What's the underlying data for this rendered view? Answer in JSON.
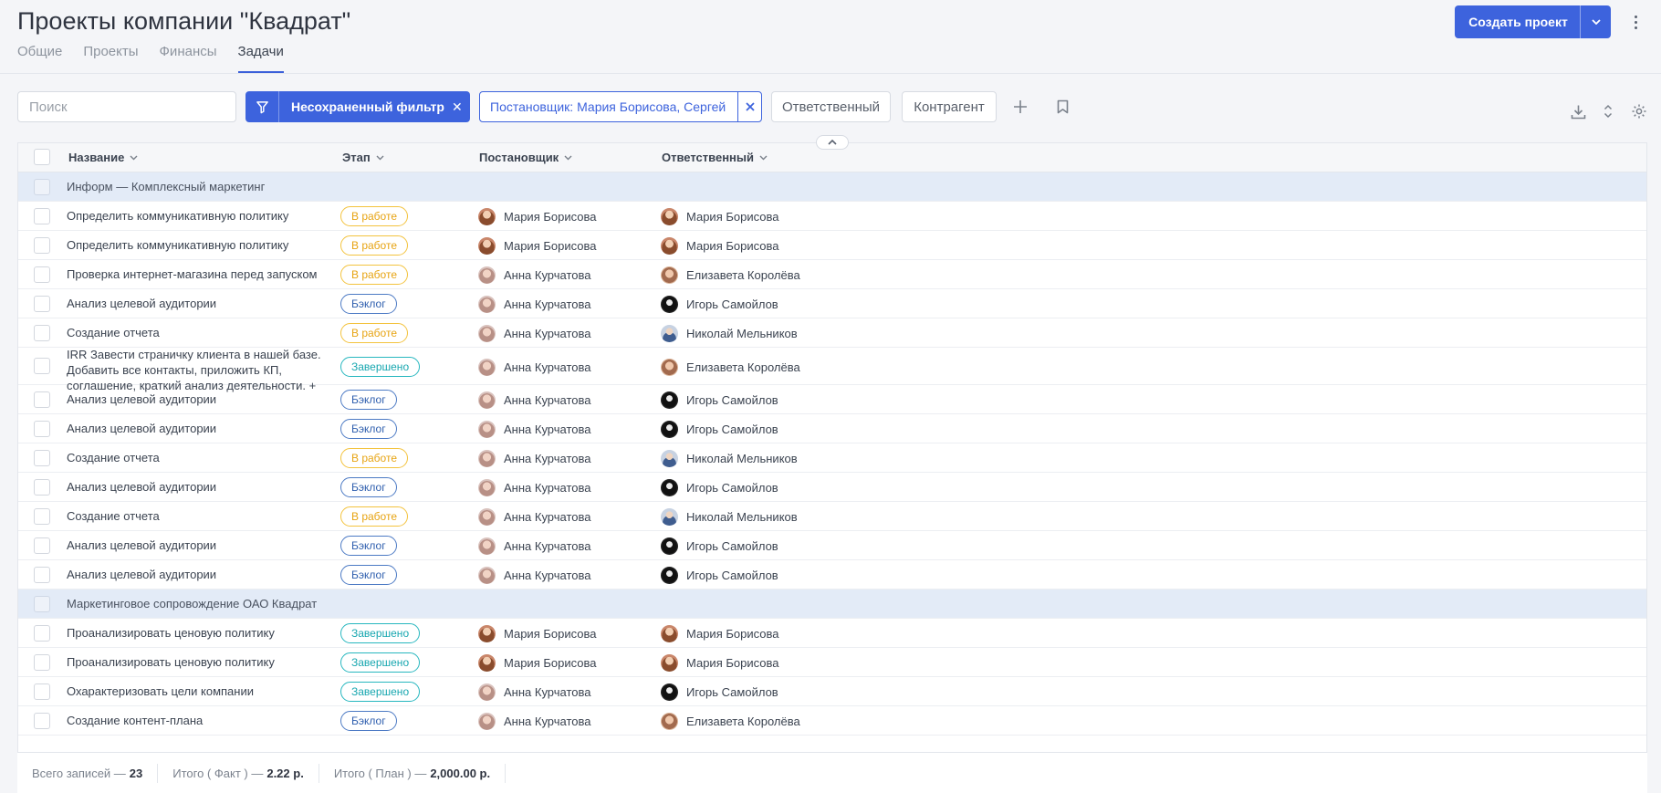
{
  "page": {
    "title": "Проекты компании \"Квадрат\"",
    "tabs": [
      {
        "label": "Общие"
      },
      {
        "label": "Проекты"
      },
      {
        "label": "Финансы"
      },
      {
        "label": "Задачи",
        "active": true
      }
    ],
    "create_button": "Создать проект"
  },
  "toolbar": {
    "search_placeholder": "Поиск",
    "filter_label": "Несохраненный фильтр",
    "active_chip": "Постановщик: Мария Борисова, Сергей",
    "chips": [
      "Ответственный",
      "Контрагент"
    ]
  },
  "table": {
    "columns": [
      "Название",
      "Этап",
      "Постановщик",
      "Ответственный"
    ],
    "groups": [
      {
        "label": "Информ — Комплексный маркетинг",
        "rows": [
          {
            "name": "Определить коммуникативную политику",
            "stage": "В работе",
            "stage_type": "work",
            "author": "Мария Борисова",
            "author_av": "maria",
            "owner": "Мария Борисова",
            "owner_av": "maria"
          },
          {
            "name": "Определить коммуникативную политику",
            "stage": "В работе",
            "stage_type": "work",
            "author": "Мария Борисова",
            "author_av": "maria",
            "owner": "Мария Борисова",
            "owner_av": "maria"
          },
          {
            "name": "Проверка интернет-магазина перед запуском",
            "stage": "В работе",
            "stage_type": "work",
            "author": "Анна Курчатова",
            "author_av": "anna",
            "owner": "Елизавета Королёва",
            "owner_av": "elis"
          },
          {
            "name": "Анализ целевой аудитории",
            "stage": "Бэклог",
            "stage_type": "back",
            "author": "Анна Курчатова",
            "author_av": "anna",
            "owner": "Игорь Самойлов",
            "owner_av": "igor"
          },
          {
            "name": "Создание отчета",
            "stage": "В работе",
            "stage_type": "work",
            "author": "Анна Курчатова",
            "author_av": "anna",
            "owner": "Николай Мельников",
            "owner_av": "nik"
          },
          {
            "name": "IRR Завести страничку клиента в нашей базе. Добавить все контакты, приложить КП, соглашение, краткий анализ деятельности.  +",
            "stage": "Завершено",
            "stage_type": "done",
            "author": "Анна Курчатова",
            "author_av": "anna",
            "owner": "Елизавета Королёва",
            "owner_av": "elis",
            "tall": true
          },
          {
            "name": "Анализ целевой аудитории",
            "stage": "Бэклог",
            "stage_type": "back",
            "author": "Анна Курчатова",
            "author_av": "anna",
            "owner": "Игорь Самойлов",
            "owner_av": "igor"
          },
          {
            "name": "Анализ целевой аудитории",
            "stage": "Бэклог",
            "stage_type": "back",
            "author": "Анна Курчатова",
            "author_av": "anna",
            "owner": "Игорь Самойлов",
            "owner_av": "igor"
          },
          {
            "name": "Создание отчета",
            "stage": "В работе",
            "stage_type": "work",
            "author": "Анна Курчатова",
            "author_av": "anna",
            "owner": "Николай Мельников",
            "owner_av": "nik"
          },
          {
            "name": "Анализ целевой аудитории",
            "stage": "Бэклог",
            "stage_type": "back",
            "author": "Анна Курчатова",
            "author_av": "anna",
            "owner": "Игорь Самойлов",
            "owner_av": "igor"
          },
          {
            "name": "Создание отчета",
            "stage": "В работе",
            "stage_type": "work",
            "author": "Анна Курчатова",
            "author_av": "anna",
            "owner": "Николай Мельников",
            "owner_av": "nik"
          },
          {
            "name": "Анализ целевой аудитории",
            "stage": "Бэклог",
            "stage_type": "back",
            "author": "Анна Курчатова",
            "author_av": "anna",
            "owner": "Игорь Самойлов",
            "owner_av": "igor"
          },
          {
            "name": "Анализ целевой аудитории",
            "stage": "Бэклог",
            "stage_type": "back",
            "author": "Анна Курчатова",
            "author_av": "anna",
            "owner": "Игорь Самойлов",
            "owner_av": "igor"
          }
        ]
      },
      {
        "label": "Маркетинговое сопровождение ОАО Квадрат",
        "rows": [
          {
            "name": "Проанализировать ценовую политику",
            "stage": "Завершено",
            "stage_type": "done",
            "author": "Мария Борисова",
            "author_av": "maria",
            "owner": "Мария Борисова",
            "owner_av": "maria"
          },
          {
            "name": "Проанализировать ценовую политику",
            "stage": "Завершено",
            "stage_type": "done",
            "author": "Мария Борисова",
            "author_av": "maria",
            "owner": "Мария Борисова",
            "owner_av": "maria"
          },
          {
            "name": "Охарактеризовать цели компании",
            "stage": "Завершено",
            "stage_type": "done",
            "author": "Анна Курчатова",
            "author_av": "anna",
            "owner": "Игорь Самойлов",
            "owner_av": "igor"
          },
          {
            "name": "Создание контент-плана",
            "stage": "Бэклог",
            "stage_type": "back",
            "author": "Анна Курчатова",
            "author_av": "anna",
            "owner": "Елизавета Королёва",
            "owner_av": "elis"
          }
        ]
      }
    ]
  },
  "footer": {
    "total_label": "Всего записей —",
    "total_value": "23",
    "fact_label": "Итого ( Факт ) —",
    "fact_value": "2.22 р.",
    "plan_label": "Итого ( План ) —",
    "plan_value": "2,000.00 р."
  },
  "colors": {
    "accent": "#3d63dd",
    "work": "#f3c33e",
    "backlog": "#4c7ac4",
    "done": "#27b7bf",
    "group_bg": "#e3ebf7"
  }
}
